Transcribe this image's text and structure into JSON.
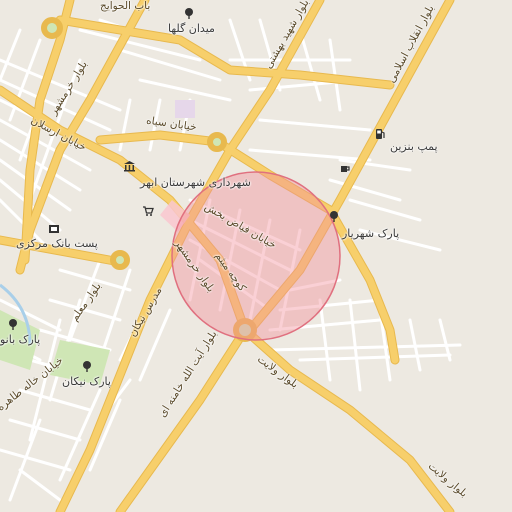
{
  "map": {
    "background": "#ede9e1",
    "colors": {
      "major_road": "#f7cf6b",
      "major_road_casing": "#e8b94e",
      "minor_road": "#ffffff",
      "park": "#cfe6b5",
      "water": "#a9cfe9",
      "highlight_fill": "#f28f9c",
      "highlight_stroke": "#e0707f"
    },
    "labels": {
      "bab_alhavayej": "باب الحوایج",
      "meydan_golha": "میدان گلها",
      "shahid_beheshti": "بلوار شهید بهشتی",
      "enghelab_eslami": "بلوار انقلاب اسلامی",
      "khorramshahr_top": "بلوار خرمشهر",
      "khorramshahr_bottom": "بلوار خرمشهر",
      "siah": "خیابان سیاه",
      "arsalan": "خیابان ارسلان",
      "pomp_benzin": "پمپ بنزین",
      "shahrdari": "شهرداری شهرستان ابهر",
      "fayaz_bakhsh": "خیابان فیاض بخش",
      "park_shahriar": "پارک شهریار",
      "post_bank": "پست بانک مرکزی",
      "koocheh_meisam": "کوچه میثم",
      "modarres": "مدرس نیکان",
      "moallem": "بلوار معلم",
      "park_banoo": "پارک بانو",
      "park_nikan": "پارک نیکان",
      "khayaban_khaleh": "خیابان خاله طاهره",
      "ayatollah_khamenei": "بلوار آیت الله خامنه ای",
      "velayat_1": "بلوار ولایت",
      "velayat_2": "بلوار ولایت"
    },
    "icons": {
      "tree": "park-tree",
      "fuel": "fuel-pump",
      "cafe": "cafe-cup",
      "government": "government-building",
      "bank": "bank",
      "shop": "shopping-cart"
    }
  }
}
